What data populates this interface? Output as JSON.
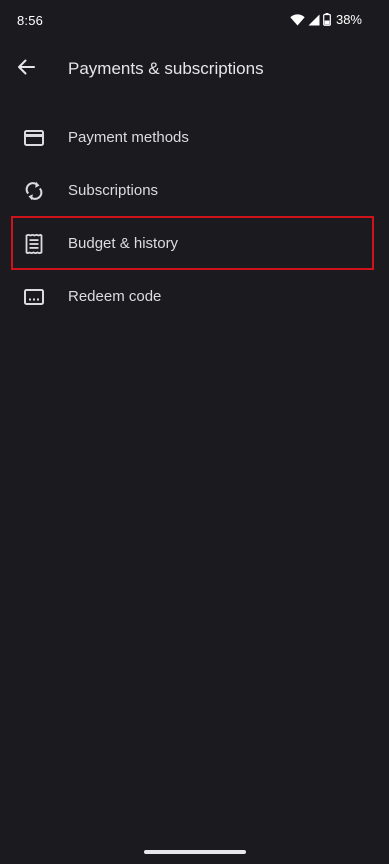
{
  "status_bar": {
    "time": "8:56",
    "battery": "38%",
    "icons": [
      "wifi-icon",
      "cell-signal-icon",
      "battery-icon"
    ]
  },
  "header": {
    "title": "Payments & subscriptions",
    "back_icon": "arrow-back-icon"
  },
  "menu": {
    "items": [
      {
        "label": "Payment methods",
        "icon": "credit-card-icon"
      },
      {
        "label": "Subscriptions",
        "icon": "sync-icon"
      },
      {
        "label": "Budget & history",
        "icon": "receipt-icon",
        "highlighted": true
      },
      {
        "label": "Redeem code",
        "icon": "redeem-code-icon"
      }
    ]
  },
  "colors": {
    "background": "#1b1b1f",
    "text": "#dcdcde",
    "highlight": "#d0121b"
  }
}
